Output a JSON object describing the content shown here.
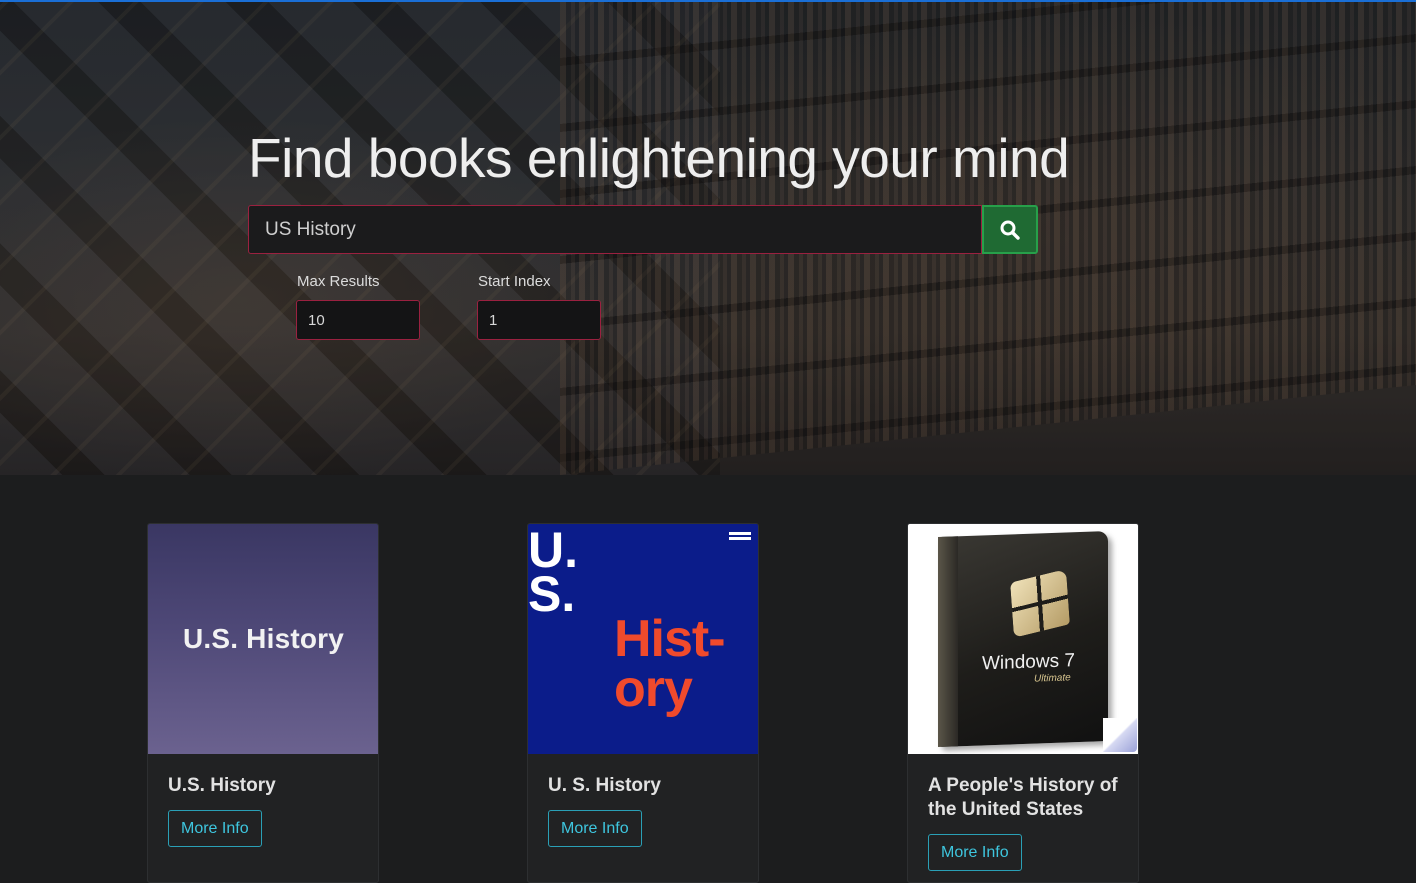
{
  "hero": {
    "title": "Find books enlightening your mind",
    "search_value": "US History",
    "search_icon": "magnifier",
    "max_results_label": "Max Results",
    "max_results_value": "10",
    "start_index_label": "Start Index",
    "start_index_value": "1"
  },
  "books": [
    {
      "title": "U.S. History",
      "cover_text": "U.S. History",
      "button": "More Info"
    },
    {
      "title": "U. S. History",
      "cover_us": "U.\nS.",
      "cover_hist": "Hist-\nory",
      "button": "More Info"
    },
    {
      "title": "A People's History of the United States",
      "cover_product": "Windows 7",
      "cover_edition": "Ultimate",
      "button": "More Info"
    }
  ],
  "colors": {
    "accent_blue": "#1a6fd6",
    "search_button": "#1f6a33",
    "input_border": "#9b2140",
    "info_button": "#3ec6de",
    "background": "#1c1d1e"
  }
}
